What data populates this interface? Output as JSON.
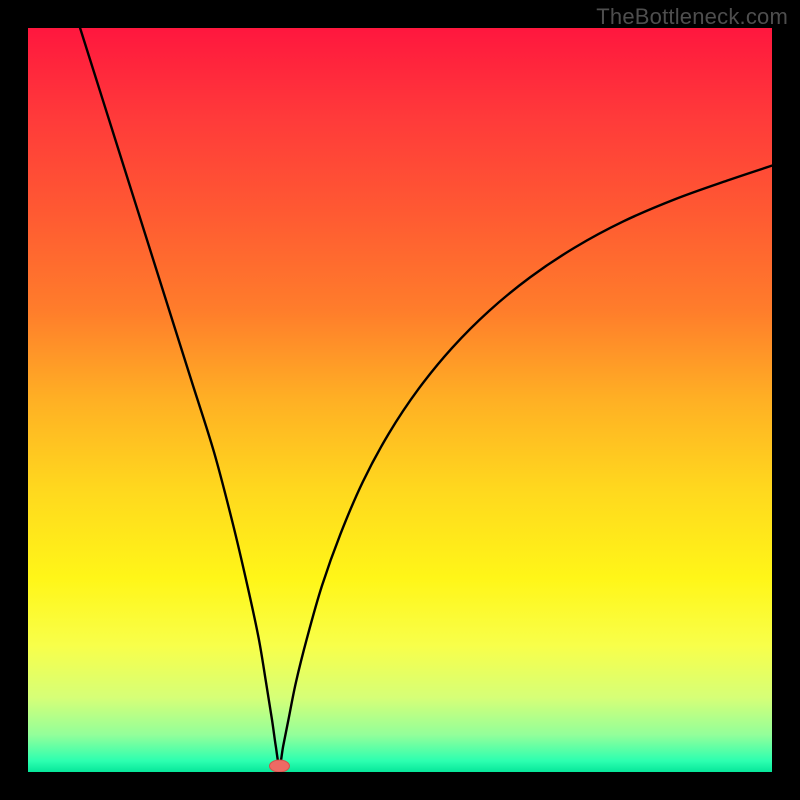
{
  "watermark": {
    "text": "TheBottleneck.com"
  },
  "chart_data": {
    "type": "line",
    "title": "",
    "xlabel": "",
    "ylabel": "",
    "xlim": [
      0,
      100
    ],
    "ylim": [
      0,
      100
    ],
    "series": [
      {
        "name": "curve",
        "x": [
          7,
          10,
          13,
          16,
          19,
          22,
          25,
          27.5,
          29.5,
          31,
          32,
          32.8,
          33.3,
          33.8,
          34.3,
          35,
          36,
          37.5,
          39.5,
          42,
          45,
          48.5,
          52.5,
          57,
          62,
          67.5,
          73.5,
          80,
          87,
          94,
          100
        ],
        "values": [
          100,
          90.5,
          81,
          71.5,
          62,
          52.5,
          43,
          33.5,
          25,
          18,
          12,
          7,
          3.5,
          0.8,
          3.5,
          7,
          12,
          18,
          25,
          32,
          39,
          45.5,
          51.5,
          57,
          62,
          66.5,
          70.5,
          74,
          77,
          79.5,
          81.5
        ]
      }
    ],
    "min_marker": {
      "x": 33.8,
      "y": 0.8
    },
    "background": {
      "type": "vertical-gradient",
      "stops": [
        {
          "pos": 0.0,
          "color": "#ff173e"
        },
        {
          "pos": 0.12,
          "color": "#ff3a3a"
        },
        {
          "pos": 0.25,
          "color": "#ff5a32"
        },
        {
          "pos": 0.38,
          "color": "#ff7d2b"
        },
        {
          "pos": 0.5,
          "color": "#ffb024"
        },
        {
          "pos": 0.62,
          "color": "#ffd81e"
        },
        {
          "pos": 0.74,
          "color": "#fff618"
        },
        {
          "pos": 0.83,
          "color": "#f8ff4a"
        },
        {
          "pos": 0.9,
          "color": "#d6ff77"
        },
        {
          "pos": 0.95,
          "color": "#93ff9a"
        },
        {
          "pos": 0.985,
          "color": "#2dffb0"
        },
        {
          "pos": 1.0,
          "color": "#06e79a"
        }
      ]
    }
  }
}
